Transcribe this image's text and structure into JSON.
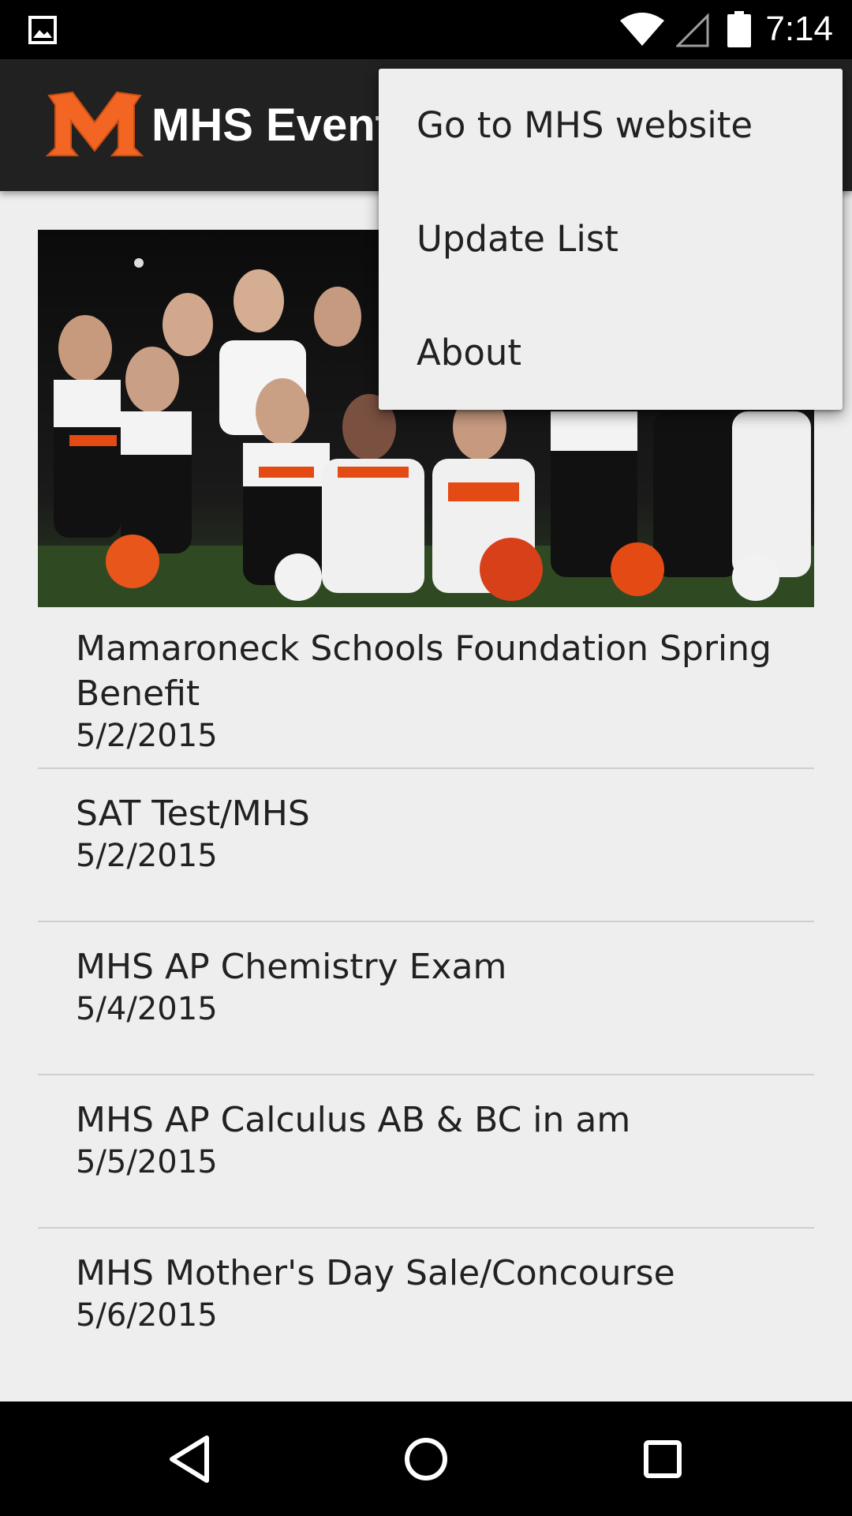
{
  "status_bar": {
    "time": "7:14",
    "icons": [
      "image-notification-icon",
      "wifi-icon",
      "cell-signal-icon",
      "battery-icon"
    ]
  },
  "app_bar": {
    "logo_icon": "mhs-m-logo-icon",
    "title": "MHS Events",
    "brand_color": "#f26522"
  },
  "hero": {
    "image_icon": "cheerleaders-photo"
  },
  "events": [
    {
      "title": "Mamaroneck Schools Foundation Spring Benefit",
      "date": "5/2/2015"
    },
    {
      "title": "SAT Test/MHS",
      "date": "5/2/2015"
    },
    {
      "title": "MHS AP Chemistry Exam",
      "date": "5/4/2015"
    },
    {
      "title": "MHS AP Calculus AB & BC in am",
      "date": "5/5/2015"
    },
    {
      "title": "MHS Mother's Day Sale/Concourse",
      "date": "5/6/2015"
    }
  ],
  "overflow_menu": {
    "items": [
      {
        "label": "Go to MHS website"
      },
      {
        "label": "Update List"
      },
      {
        "label": "About"
      }
    ]
  },
  "nav_bar": {
    "icons": [
      "back-icon",
      "home-icon",
      "recents-icon"
    ]
  }
}
